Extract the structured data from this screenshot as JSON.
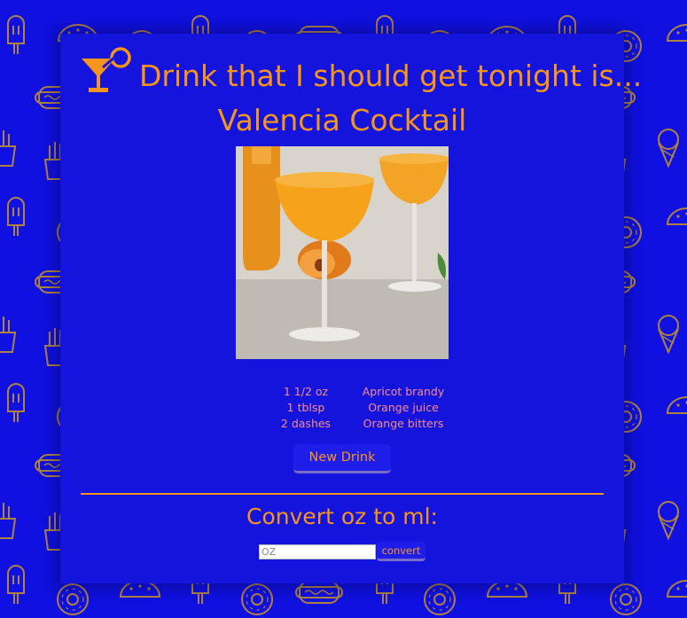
{
  "header": {
    "title": "Drink that I should get tonight is...",
    "icon": "cocktail-glass-icon"
  },
  "drink": {
    "name": "Valencia Cocktail",
    "image_alt": "Valencia Cocktail",
    "ingredients": [
      {
        "measure": "1 1/2 oz",
        "name": "Apricot brandy"
      },
      {
        "measure": "1 tblsp",
        "name": "Orange juice"
      },
      {
        "measure": "2 dashes",
        "name": "Orange bitters"
      }
    ]
  },
  "actions": {
    "new_drink_label": "New Drink"
  },
  "converter": {
    "heading": "Convert oz to ml:",
    "input_placeholder": "OZ",
    "input_value": "",
    "button_label": "convert"
  },
  "colors": {
    "background": "#1010e0",
    "accent": "#f7941d",
    "ingredient_text": "#f88a8a",
    "button_underline": "#7a6cc8"
  },
  "background_pattern_icons": [
    "popsicle-icon",
    "taco-icon",
    "donut-icon",
    "hot-dog-icon",
    "burger-icon",
    "ice-cream-cone-icon",
    "soda-cup-icon",
    "fries-icon"
  ]
}
